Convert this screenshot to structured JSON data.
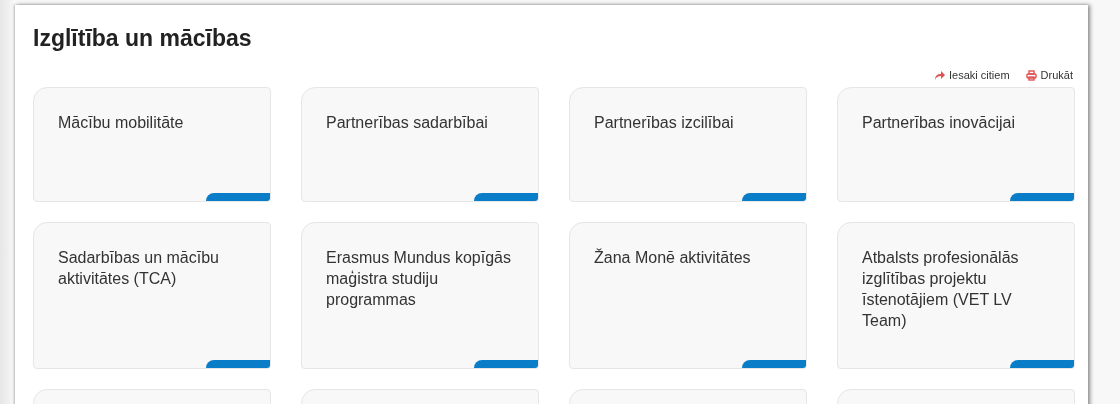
{
  "title": "Izglītība un mācības",
  "actions": [
    {
      "kind": "share",
      "label": "Iesaki citiem"
    },
    {
      "kind": "print",
      "label": "Drukāt"
    }
  ],
  "cards": [
    {
      "title": "Mācību mobilitāte"
    },
    {
      "title": "Partnerības sadarbībai"
    },
    {
      "title": "Partnerības izcilībai"
    },
    {
      "title": "Partnerības inovācijai"
    },
    {
      "title": "Sadarbības un mācību aktivitātes (TCA)"
    },
    {
      "title": "Erasmus Mundus kopīgās maģistra studiju programmas"
    },
    {
      "title": "Žana Monē aktivitātes"
    },
    {
      "title": "Atbalsts profesionālās izglītības projektu īstenotājiem (VET LV Team)"
    }
  ]
}
